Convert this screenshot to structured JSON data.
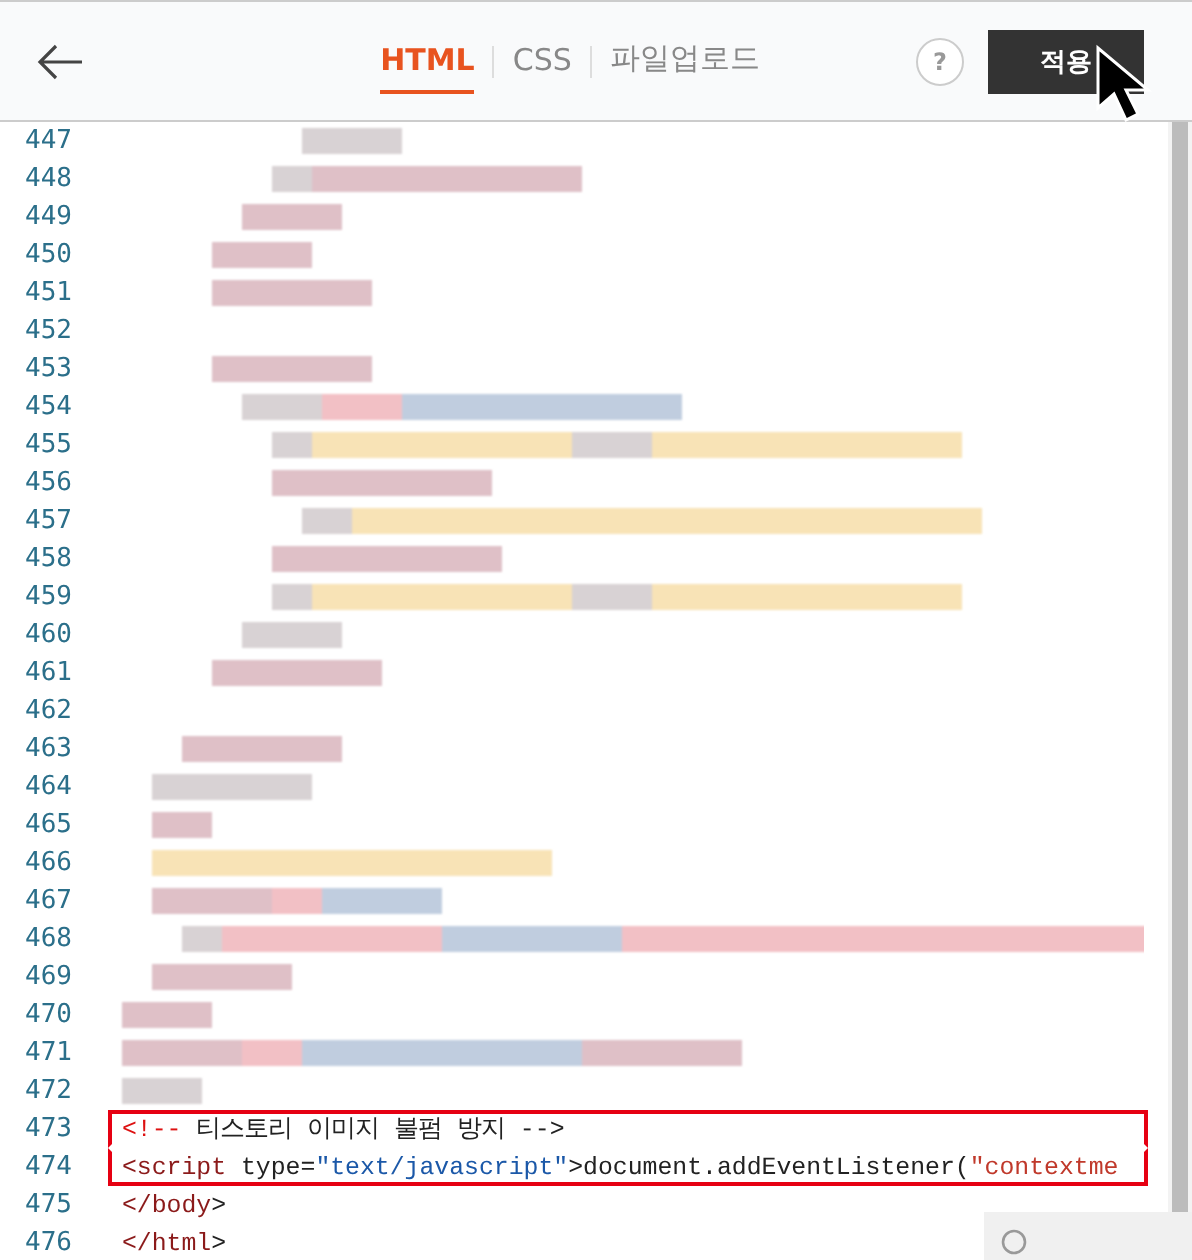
{
  "header": {
    "tabs": [
      {
        "label": "HTML",
        "selected": true
      },
      {
        "label": "CSS",
        "selected": false
      },
      {
        "label": "파일업로드",
        "selected": false
      }
    ],
    "help": "?",
    "apply_button": "적용"
  },
  "editor": {
    "lines": [
      {
        "number": "447",
        "kind": "pixelated",
        "highlighted": false
      },
      {
        "number": "448",
        "kind": "pixelated",
        "highlighted": false
      },
      {
        "number": "449",
        "kind": "pixelated",
        "highlighted": false
      },
      {
        "number": "450",
        "kind": "pixelated",
        "highlighted": false
      },
      {
        "number": "451",
        "kind": "pixelated",
        "highlighted": false
      },
      {
        "number": "452",
        "kind": "blank",
        "highlighted": false
      },
      {
        "number": "453",
        "kind": "pixelated",
        "highlighted": false
      },
      {
        "number": "454",
        "kind": "pixelated",
        "highlighted": false
      },
      {
        "number": "455",
        "kind": "pixelated",
        "highlighted": false
      },
      {
        "number": "456",
        "kind": "pixelated",
        "highlighted": false
      },
      {
        "number": "457",
        "kind": "pixelated",
        "highlighted": false
      },
      {
        "number": "458",
        "kind": "pixelated",
        "highlighted": false
      },
      {
        "number": "459",
        "kind": "pixelated",
        "highlighted": false
      },
      {
        "number": "460",
        "kind": "pixelated",
        "highlighted": false
      },
      {
        "number": "461",
        "kind": "pixelated",
        "highlighted": false
      },
      {
        "number": "462",
        "kind": "blank",
        "highlighted": false
      },
      {
        "number": "463",
        "kind": "pixelated",
        "highlighted": false
      },
      {
        "number": "464",
        "kind": "pixelated",
        "highlighted": false
      },
      {
        "number": "465",
        "kind": "pixelated",
        "highlighted": false
      },
      {
        "number": "466",
        "kind": "pixelated",
        "highlighted": false
      },
      {
        "number": "467",
        "kind": "pixelated",
        "highlighted": false
      },
      {
        "number": "468",
        "kind": "pixelated",
        "highlighted": false
      },
      {
        "number": "469",
        "kind": "pixelated",
        "highlighted": false
      },
      {
        "number": "470",
        "kind": "pixelated",
        "highlighted": false
      },
      {
        "number": "471",
        "kind": "pixelated",
        "highlighted": false
      },
      {
        "number": "472",
        "kind": "pixelated",
        "highlighted": false
      },
      {
        "number": "473",
        "kind": "code",
        "highlighted": true,
        "code": "<!-- 티스토리 이미지 불펌 방지 -->"
      },
      {
        "number": "474",
        "kind": "code",
        "highlighted": true,
        "code": "<script type=\"text/javascript\">document.addEventListener(\"contextme"
      },
      {
        "number": "475",
        "kind": "code",
        "highlighted": false,
        "code": "</body>"
      },
      {
        "number": "476",
        "kind": "code",
        "highlighted": false,
        "code": "</html>"
      }
    ]
  }
}
